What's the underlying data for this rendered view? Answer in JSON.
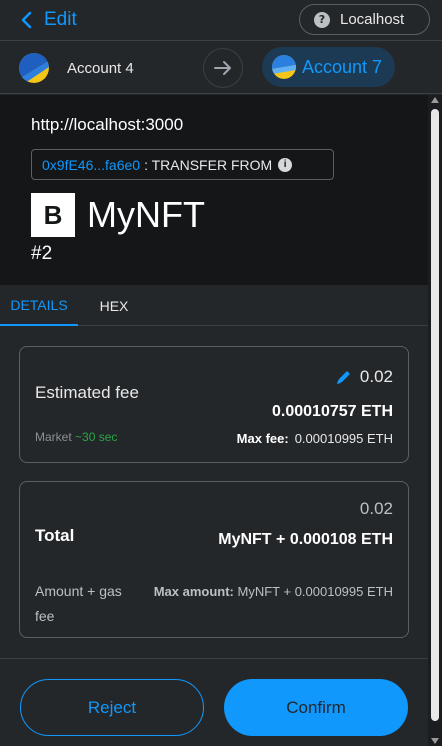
{
  "header": {
    "back_label": "Edit",
    "network_label": "Localhost"
  },
  "accounts": {
    "from_name": "Account 4",
    "to_name": "Account 7"
  },
  "summary": {
    "origin": "http://localhost:3000",
    "contract_address": "0x9fE46...fa6e0",
    "action": ": TRANSFER FROM",
    "nft_logo_letter": "B",
    "nft_name": "MyNFT",
    "token_id": "#2"
  },
  "tabs": [
    "DETAILS",
    "HEX"
  ],
  "fee_card": {
    "label": "Estimated fee",
    "fiat_value": "0.02",
    "eth_value": "0.00010757 ETH",
    "market_label": "Market",
    "market_time": "~30 sec",
    "max_fee_label": "Max fee:",
    "max_fee_value": "0.00010995 ETH"
  },
  "total_card": {
    "fiat_value": "0.02",
    "label": "Total",
    "value": "MyNFT + 0.000108 ETH",
    "amount_gas_label": "Amount + gas fee",
    "max_amount_label": "Max amount:",
    "max_amount_value": "MyNFT + 0.00010995 ETH"
  },
  "footer": {
    "reject_label": "Reject",
    "confirm_label": "Confirm"
  },
  "colors": {
    "accent": "#1098fc",
    "background": "#24272a",
    "summary_bg": "#141618",
    "success": "#28a745"
  },
  "icons": [
    "chevron-left-icon",
    "question-icon",
    "account-avatar-icon",
    "arrow-right-icon",
    "info-icon",
    "pencil-icon"
  ]
}
